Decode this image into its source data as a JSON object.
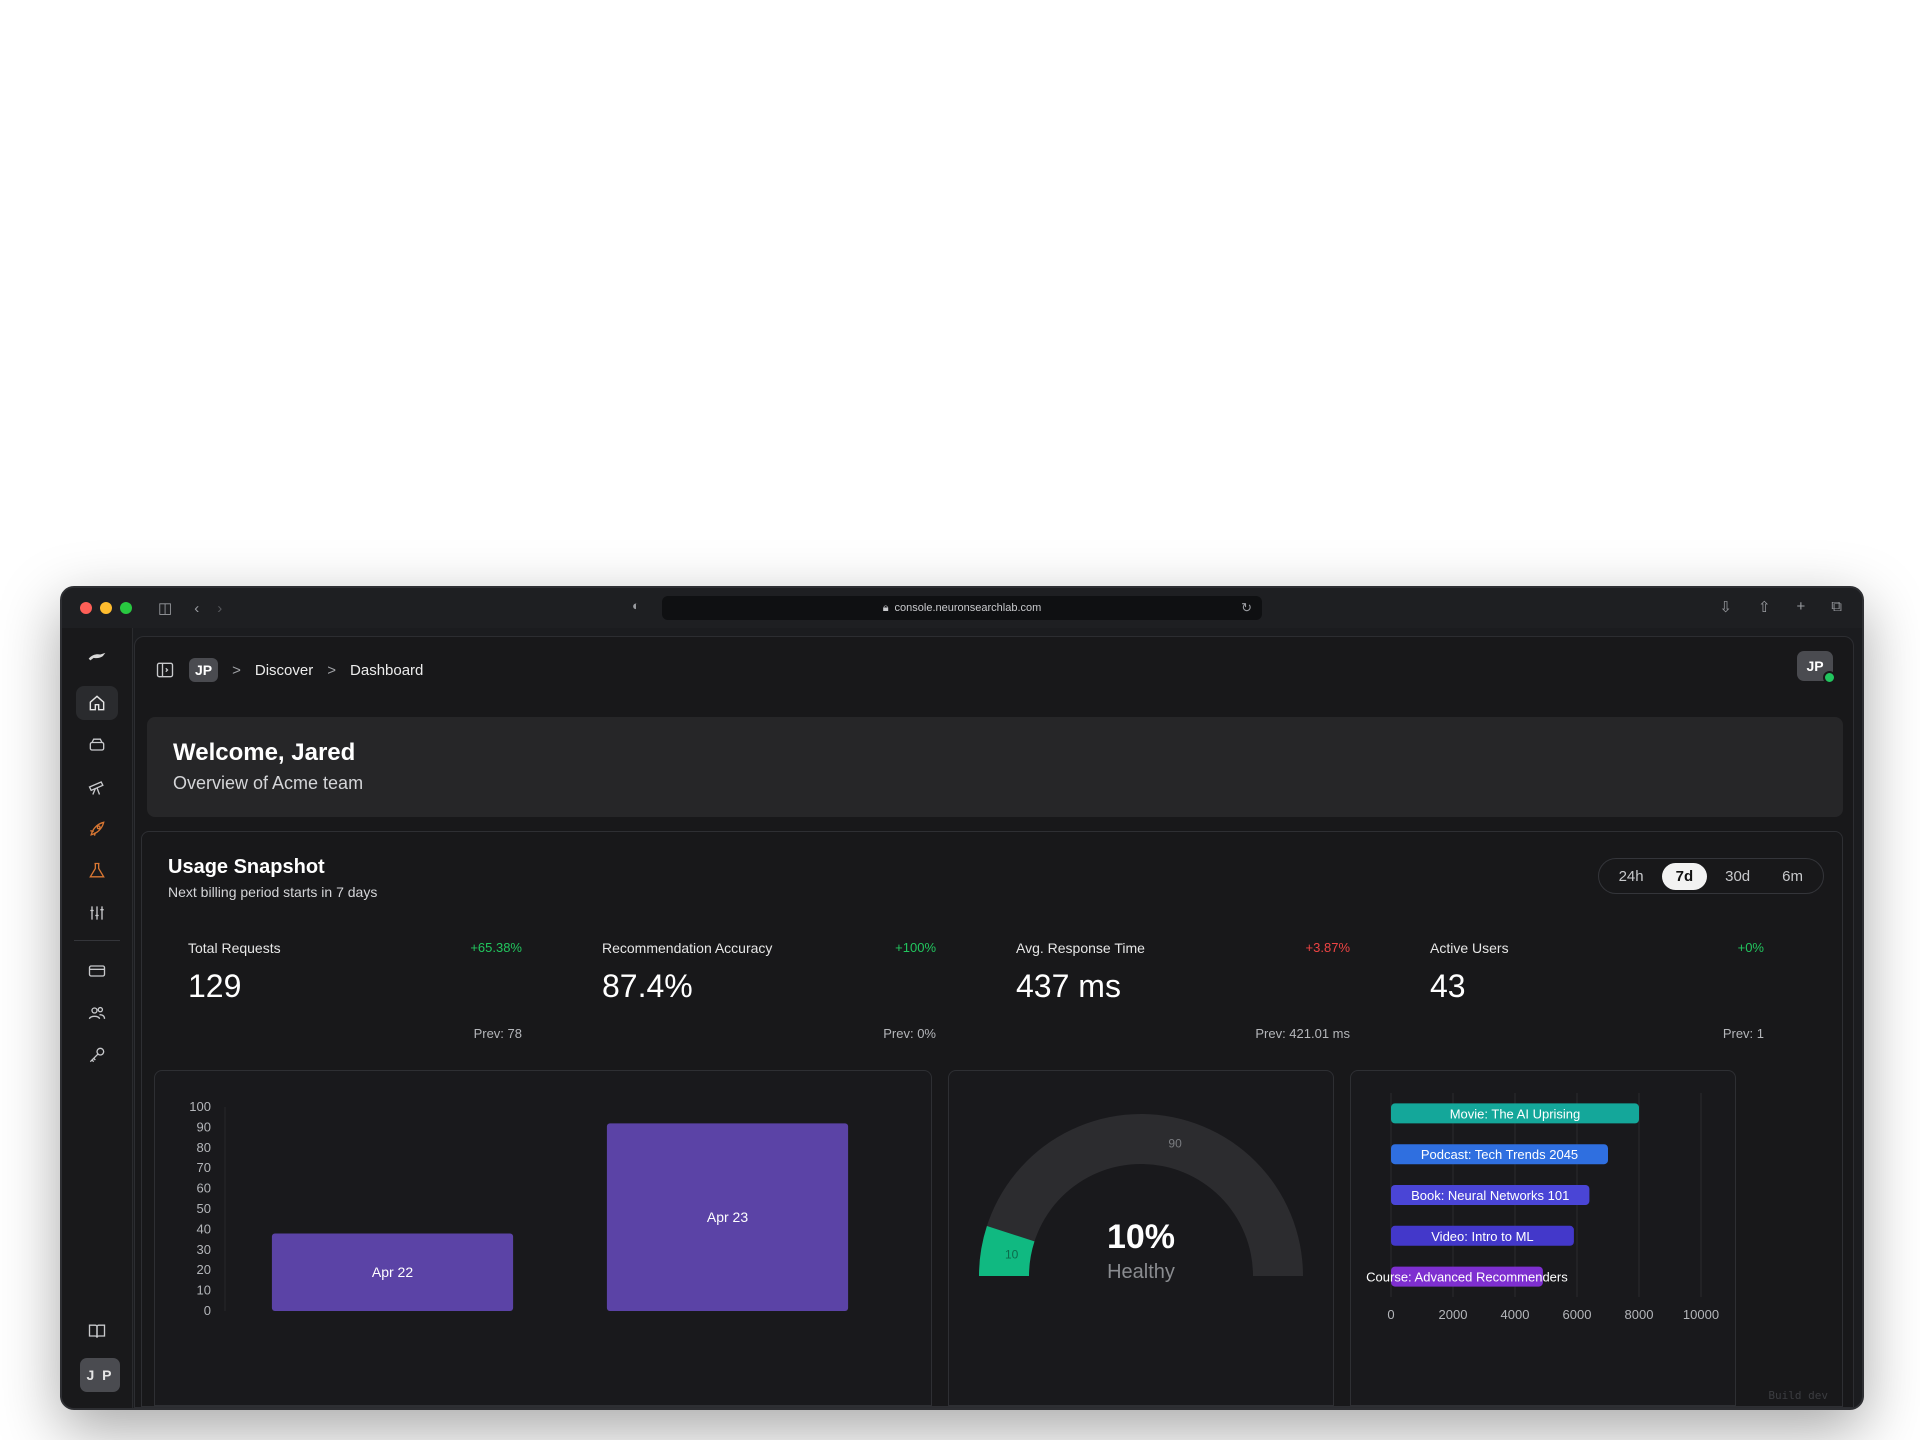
{
  "browser": {
    "url": "console.neuronsearchlab.com"
  },
  "breadcrumb": {
    "team": "JP",
    "items": [
      "Discover",
      "Dashboard"
    ]
  },
  "user": {
    "initials": "JP",
    "sidebar_initials": "J P"
  },
  "welcome": {
    "title": "Welcome, Jared",
    "subtitle": "Overview of Acme team"
  },
  "usage": {
    "title": "Usage Snapshot",
    "subtitle": "Next billing period starts in 7 days",
    "ranges": [
      "24h",
      "7d",
      "30d",
      "6m"
    ],
    "active_range": "7d"
  },
  "metrics": [
    {
      "label": "Total Requests",
      "delta": "+65.38%",
      "delta_dir": "up",
      "value": "129",
      "prev": "Prev: 78"
    },
    {
      "label": "Recommendation Accuracy",
      "delta": "+100%",
      "delta_dir": "up",
      "value": "87.4%",
      "prev": "Prev: 0%"
    },
    {
      "label": "Avg. Response Time",
      "delta": "+3.87%",
      "delta_dir": "down",
      "value": "437 ms",
      "prev": "Prev: 421.01 ms"
    },
    {
      "label": "Active Users",
      "delta": "+0%",
      "delta_dir": "up",
      "value": "43",
      "prev": "Prev: 1"
    }
  ],
  "icons": {
    "sidebar": [
      "home-icon",
      "layers-icon",
      "telescope-icon",
      "rocket-icon",
      "flask-icon",
      "sliders-icon",
      "card-icon",
      "users-icon",
      "key-icon",
      "book-icon"
    ]
  },
  "colors": {
    "bar_purple": "#5b43a6",
    "gauge_green": "#10b981",
    "gauge_track": "#2c2c2f",
    "hbar_colors": [
      "#14a79a",
      "#2f6fe0",
      "#4a45d6",
      "#4338ca",
      "#7e2fd0"
    ]
  },
  "chart_data": [
    {
      "type": "bar",
      "categories": [
        "Apr 22",
        "Apr 23"
      ],
      "values": [
        38,
        92
      ],
      "ylim": [
        0,
        100
      ],
      "yticks": [
        0,
        10,
        20,
        30,
        40,
        50,
        60,
        70,
        80,
        90,
        100
      ]
    },
    {
      "type": "gauge",
      "value": 10,
      "max": 100,
      "value_label": "10%",
      "status": "Healthy",
      "marker_labels": [
        "10",
        "90"
      ]
    },
    {
      "type": "bar",
      "orientation": "horizontal",
      "categories": [
        "Movie: The AI Uprising",
        "Podcast: Tech Trends 2045",
        "Book: Neural Networks 101",
        "Video: Intro to ML",
        "Course: Advanced Recommenders"
      ],
      "values": [
        8000,
        7000,
        6400,
        5900,
        4900
      ],
      "xlim": [
        0,
        10000
      ],
      "xticks": [
        0,
        2000,
        4000,
        6000,
        8000,
        10000
      ]
    }
  ],
  "footer": {
    "build": "Build dev"
  }
}
